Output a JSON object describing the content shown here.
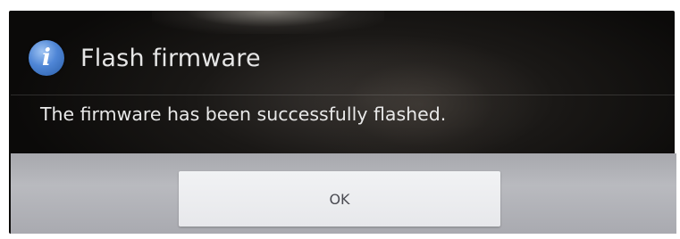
{
  "dialog": {
    "title": "Flash firmware",
    "icon": "info-icon",
    "icon_glyph": "i",
    "message": "The firmware has been successfully flashed.",
    "ok_label": "OK"
  },
  "colors": {
    "dialog_background": "#0b0a09",
    "title_text": "#e6e6e6",
    "message_text": "#e8e8e8",
    "button_bar": "#b9babf",
    "button_face": "#eceef0",
    "button_text": "#4a4b52",
    "icon_blue": "#4f86d6"
  }
}
